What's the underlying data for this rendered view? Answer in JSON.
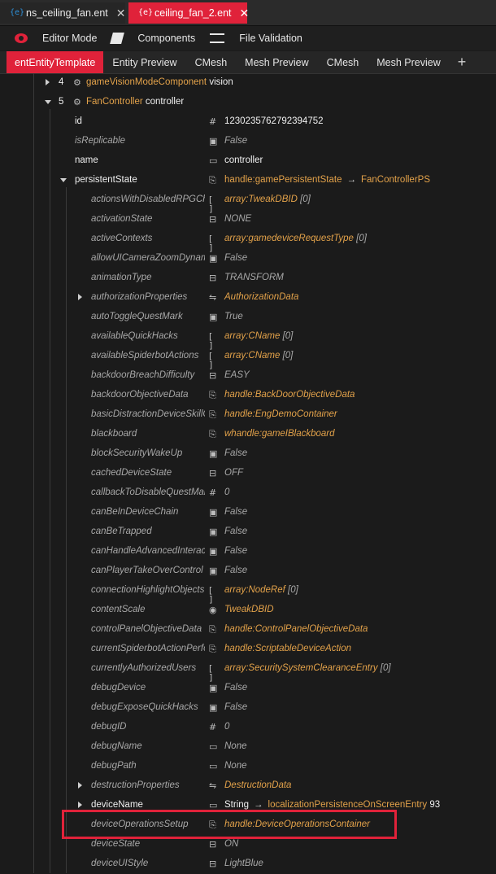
{
  "file_tabs": [
    {
      "label": "ns_ceiling_fan.ent",
      "active": false
    },
    {
      "label": "ceiling_fan_2.ent",
      "active": true
    }
  ],
  "toolbar": {
    "editor_mode": "Editor Mode",
    "components": "Components",
    "file_validation": "File Validation"
  },
  "sub_tabs": [
    "entEntityTemplate",
    "Entity Preview",
    "CMesh",
    "Mesh Preview",
    "CMesh",
    "Mesh Preview"
  ],
  "plus": "+",
  "components": [
    {
      "num": "4",
      "type": "gameVisionModeComponent",
      "name": "vision"
    },
    {
      "num": "5",
      "type": "FanController",
      "name": "controller"
    }
  ],
  "fields": {
    "id": {
      "name": "id",
      "value": "1230235762792394752"
    },
    "isReplicable": {
      "name": "isReplicable",
      "value": "False"
    },
    "name": {
      "name": "name",
      "value": "controller"
    },
    "persistentState": {
      "name": "persistentState",
      "type": "handle:gamePersistentState",
      "arrow": "→",
      "target": "FanControllerPS"
    }
  },
  "props": [
    {
      "name": "actionsWithDisabledRPGChecks",
      "icon": "[ ]",
      "type": "array:TweakDBID",
      "count": "[0]"
    },
    {
      "name": "activationState",
      "icon": "enum",
      "value": "NONE"
    },
    {
      "name": "activeContexts",
      "icon": "[ ]",
      "type": "array:gamedeviceRequestType",
      "count": "[0]"
    },
    {
      "name": "allowUICameraZoomDynamicCamera",
      "icon": "bool",
      "value": "False"
    },
    {
      "name": "animationType",
      "icon": "enum",
      "value": "TRANSFORM"
    },
    {
      "name": "authorizationProperties",
      "icon": "struct",
      "type": "AuthorizationData",
      "expandable": true
    },
    {
      "name": "autoToggleQuestMark",
      "icon": "bool",
      "value": "True"
    },
    {
      "name": "availableQuickHacks",
      "icon": "[ ]",
      "type": "array:CName",
      "count": "[0]"
    },
    {
      "name": "availableSpiderbotActions",
      "icon": "[ ]",
      "type": "array:CName",
      "count": "[0]"
    },
    {
      "name": "backdoorBreachDifficulty",
      "icon": "enum",
      "value": "EASY"
    },
    {
      "name": "backdoorObjectiveData",
      "icon": "handle",
      "type": "handle:BackDoorObjectiveData"
    },
    {
      "name": "basicDistractionDeviceSkillChecks",
      "icon": "handle",
      "type": "handle:EngDemoContainer"
    },
    {
      "name": "blackboard",
      "icon": "handle",
      "type": "whandle:gameIBlackboard"
    },
    {
      "name": "blockSecurityWakeUp",
      "icon": "bool",
      "value": "False"
    },
    {
      "name": "cachedDeviceState",
      "icon": "enum",
      "value": "OFF"
    },
    {
      "name": "callbackToDisableQuestMarkID",
      "icon": "#",
      "value": "0"
    },
    {
      "name": "canBeInDeviceChain",
      "icon": "bool",
      "value": "False"
    },
    {
      "name": "canBeTrapped",
      "icon": "bool",
      "value": "False"
    },
    {
      "name": "canHandleAdvancedInteraction",
      "icon": "bool",
      "value": "False"
    },
    {
      "name": "canPlayerTakeOverControl",
      "icon": "bool",
      "value": "False"
    },
    {
      "name": "connectionHighlightObjects",
      "icon": "[ ]",
      "type": "array:NodeRef",
      "count": "[0]"
    },
    {
      "name": "contentScale",
      "icon": "tweak",
      "type": "TweakDBID"
    },
    {
      "name": "controlPanelObjectiveData",
      "icon": "handle",
      "type": "handle:ControlPanelObjectiveData"
    },
    {
      "name": "currentSpiderbotActionPerformed",
      "icon": "handle",
      "type": "handle:ScriptableDeviceAction"
    },
    {
      "name": "currentlyAuthorizedUsers",
      "icon": "[ ]",
      "type": "array:SecuritySystemClearanceEntry",
      "count": "[0]"
    },
    {
      "name": "debugDevice",
      "icon": "bool",
      "value": "False"
    },
    {
      "name": "debugExposeQuickHacks",
      "icon": "bool",
      "value": "False"
    },
    {
      "name": "debugID",
      "icon": "#",
      "value": "0"
    },
    {
      "name": "debugName",
      "icon": "str",
      "value": "None"
    },
    {
      "name": "debugPath",
      "icon": "str",
      "value": "None"
    },
    {
      "name": "destructionProperties",
      "icon": "struct",
      "type": "DestructionData",
      "expandable": true
    },
    {
      "name": "deviceName",
      "icon": "str",
      "set": true,
      "value": "String",
      "arrow": "→",
      "target": "localizationPersistenceOnScreenEntry",
      "extra": "93",
      "expandable": true
    },
    {
      "name": "deviceOperationsSetup",
      "icon": "handle",
      "type": "handle:DeviceOperationsContainer"
    },
    {
      "name": "deviceState",
      "icon": "enum",
      "value": "ON"
    },
    {
      "name": "deviceUIStyle",
      "icon": "enum",
      "value": "LightBlue"
    }
  ]
}
